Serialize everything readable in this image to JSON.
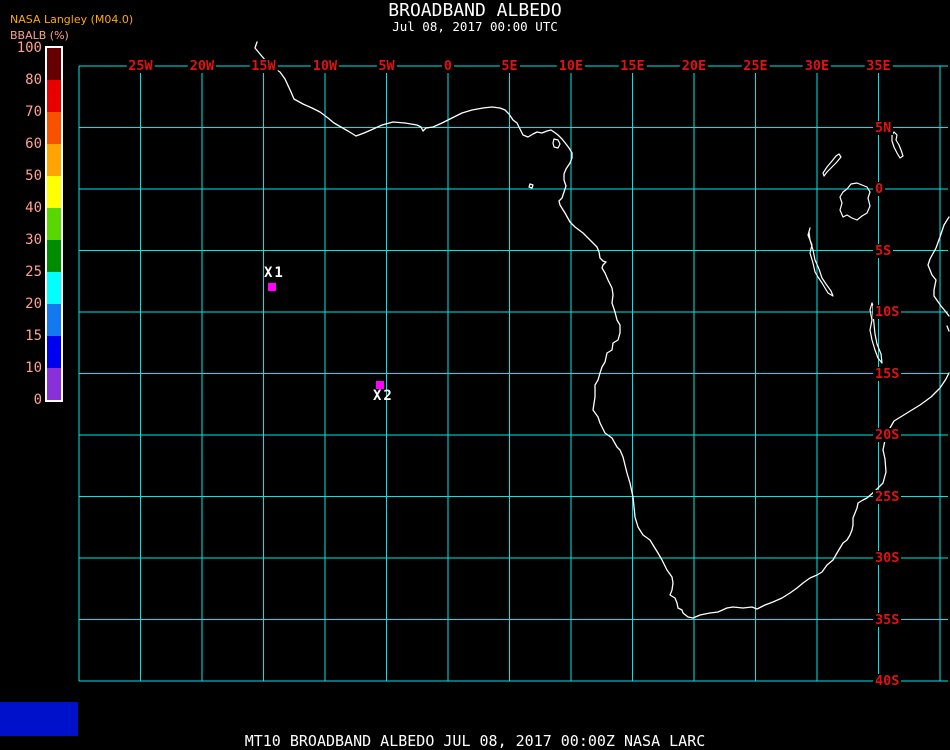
{
  "header": {
    "title": "BROADBAND ALBEDO",
    "subtitle": "Jul 08, 2017 00:00 UTC"
  },
  "branding": {
    "source": "NASA Langley (M04.0)",
    "parameter_label": "BBALB (%)"
  },
  "colorbar": {
    "tick_labels": [
      "100",
      "80",
      "70",
      "60",
      "50",
      "40",
      "30",
      "25",
      "20",
      "15",
      "10",
      "0"
    ],
    "segment_colors": [
      "#640000",
      "#e80000",
      "#f85200",
      "#ffa400",
      "#ffff00",
      "#58d800",
      "#008c00",
      "#00ffff",
      "#1478f0",
      "#0000f0",
      "#8a30d8"
    ],
    "tick_color": "#ffa28c"
  },
  "map": {
    "lon_labels": [
      "25W",
      "20W",
      "15W",
      "10W",
      "5W",
      "0",
      "5E",
      "10E",
      "15E",
      "20E",
      "25E",
      "30E",
      "35E"
    ],
    "lat_labels": [
      "5N",
      "0",
      "5S",
      "10S",
      "15S",
      "20S",
      "25S",
      "30S",
      "35S",
      "40S"
    ],
    "grid_color": "#00e6e6",
    "axis_label_color": "#e01212",
    "coast_color": "#ffffff",
    "marker_color": "#ff00ff",
    "markers": [
      {
        "id": "X1"
      },
      {
        "id": "X2"
      }
    ]
  },
  "footer": {
    "status_line": "MT10  BROADBAND ALBEDO   JUL 08, 2017 00:00Z   NASA LARC"
  },
  "legend_block": {
    "color": "#0011cc"
  }
}
